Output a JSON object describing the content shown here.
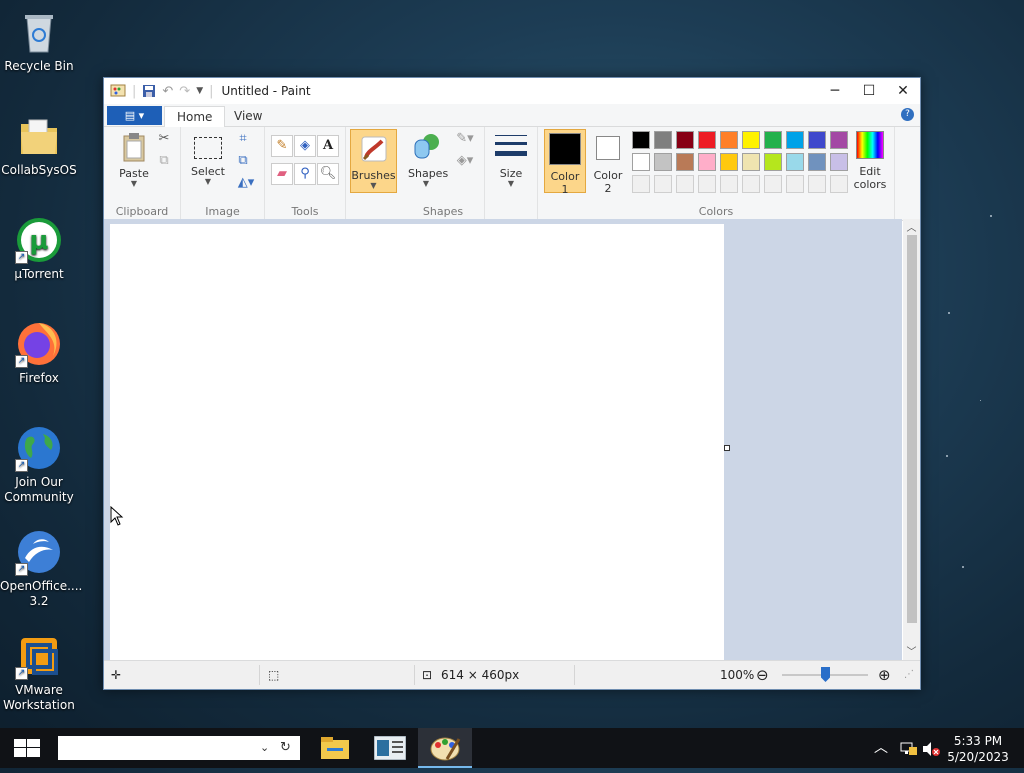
{
  "desktop": {
    "icons": [
      {
        "label": "Recycle Bin",
        "icon": "recycle-bin-icon"
      },
      {
        "label": "CollabSysOS",
        "icon": "folder-icon"
      },
      {
        "label": "µTorrent",
        "icon": "utorrent-icon"
      },
      {
        "label": "Firefox",
        "icon": "firefox-icon"
      },
      {
        "label": "Join Our Community",
        "icon": "globe-icon"
      },
      {
        "label": "OpenOffice.... 3.2",
        "icon": "openoffice-icon"
      },
      {
        "label": "VMware Workstation",
        "icon": "vmware-icon"
      }
    ]
  },
  "window": {
    "title": "Untitled - Paint",
    "buttons": {
      "minimize": "─",
      "maximize": "☐",
      "close": "✕"
    }
  },
  "ribbon": {
    "file_menu_label": "▤ ▾",
    "tabs": [
      {
        "label": "Home",
        "active": true
      },
      {
        "label": "View",
        "active": false
      }
    ],
    "help": "?",
    "groups": {
      "clipboard": {
        "label": "Clipboard",
        "paste": "Paste"
      },
      "image": {
        "label": "Image",
        "select": "Select"
      },
      "tools": {
        "label": "Tools"
      },
      "brushes": {
        "label": "Brushes"
      },
      "shapes": {
        "label": "Shapes",
        "shapes": "Shapes"
      },
      "size": {
        "label": "Size"
      },
      "colors": {
        "label": "Colors",
        "color1_line1": "Color",
        "color1_line2": "1",
        "color2_line1": "Color",
        "color2_line2": "2",
        "edit_line1": "Edit",
        "edit_line2": "colors",
        "color1": "#000000",
        "color2": "#ffffff",
        "palette_row1": [
          "#000000",
          "#7f7f7f",
          "#880015",
          "#ed1c24",
          "#ff7f27",
          "#fff200",
          "#22b14c",
          "#00a2e8",
          "#3f48cc",
          "#a349a4"
        ],
        "palette_row2": [
          "#ffffff",
          "#c3c3c3",
          "#b97a57",
          "#ffaec9",
          "#ffc90e",
          "#efe4b0",
          "#b5e61d",
          "#99d9ea",
          "#7092be",
          "#c8bfe7"
        ],
        "palette_row3": [
          "#f0f0f0",
          "#f0f0f0",
          "#f0f0f0",
          "#f0f0f0",
          "#f0f0f0",
          "#f0f0f0",
          "#f0f0f0",
          "#f0f0f0",
          "#f0f0f0",
          "#f0f0f0"
        ]
      }
    }
  },
  "statusbar": {
    "cursor_pos": "",
    "selection_size": "",
    "canvas_size": "614 × 460px",
    "zoom": "100%",
    "zoom_fraction": 0.5
  },
  "taskbar": {
    "search_value": "",
    "clock_time": "5:33 PM",
    "clock_date": "5/20/2023"
  }
}
